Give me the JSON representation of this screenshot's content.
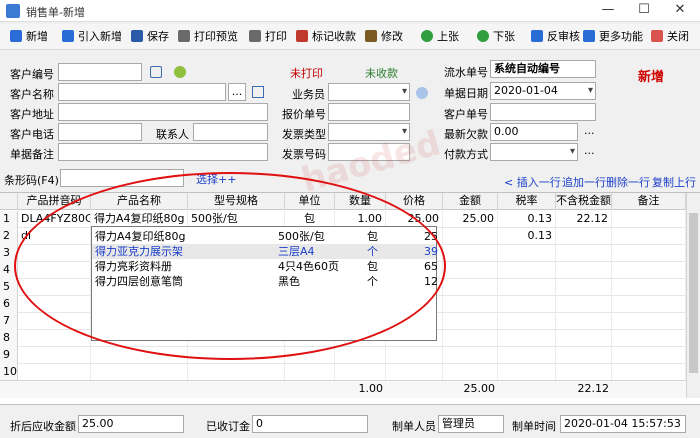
{
  "window": {
    "title": "销售单-新增",
    "min_glyph": "—",
    "max_glyph": "☐",
    "close_glyph": "✕"
  },
  "toolbar": [
    {
      "name": "new-button",
      "icon": "plus-icon",
      "color": "#2a6cd6",
      "label": "新增"
    },
    {
      "name": "import-add-button",
      "icon": "plus-icon",
      "color": "#2a6cd6",
      "label": "引入新增"
    },
    {
      "name": "save-button",
      "icon": "disk-icon",
      "color": "#2a5aa8",
      "label": "保存"
    },
    {
      "name": "print-preview-button",
      "icon": "printer-icon",
      "color": "#6a6a6a",
      "label": "打印预览"
    },
    {
      "name": "print-button",
      "icon": "printer-icon",
      "color": "#6a6a6a",
      "label": "打印"
    },
    {
      "name": "mark-paid-button",
      "icon": "dots-icon",
      "color": "#c0392b",
      "label": "标记收款"
    },
    {
      "name": "edit-button",
      "icon": "tools-icon",
      "color": "#7a5a20",
      "label": "修改"
    },
    {
      "name": "prev-button",
      "icon": "up-circle-icon",
      "color": "#2e9e3e",
      "label": "上张"
    },
    {
      "name": "next-button",
      "icon": "down-circle-icon",
      "color": "#2e9e3e",
      "label": "下张"
    },
    {
      "name": "unaudit-button",
      "icon": "undo-icon",
      "color": "#2a6cd6",
      "label": "反审核"
    },
    {
      "name": "more-button",
      "icon": "grid-icon",
      "color": "#2a6cd6",
      "label": "更多功能"
    },
    {
      "name": "close-button",
      "icon": "close-icon",
      "color": "#d9534f",
      "label": "关闭"
    }
  ],
  "form": {
    "customer_code": {
      "label": "客户编号",
      "value": ""
    },
    "customer_name": {
      "label": "客户名称",
      "value": "",
      "button": "..."
    },
    "customer_address": {
      "label": "客户地址",
      "value": ""
    },
    "customer_phone": {
      "label": "客户电话",
      "value": ""
    },
    "contact": {
      "label": "联系人",
      "value": ""
    },
    "remark": {
      "label": "单据备注",
      "value": ""
    },
    "print_status": "未打印",
    "pay_status": "未收款",
    "salesman": {
      "label": "业务员",
      "value": ""
    },
    "quote_no": {
      "label": "报价单号",
      "value": ""
    },
    "invoice_type": {
      "label": "发票类型",
      "value": ""
    },
    "invoice_no": {
      "label": "发票号码",
      "value": ""
    },
    "serial_no": {
      "label": "流水单号",
      "value": "系统自动编号"
    },
    "doc_date": {
      "label": "单据日期",
      "value": "2020-01-04"
    },
    "customer_order_no": {
      "label": "客户单号",
      "value": ""
    },
    "latest_debt": {
      "label": "最新欠款",
      "value": "0.00"
    },
    "pay_method": {
      "label": "付款方式",
      "value": ""
    },
    "mode_badge": "新增",
    "watermark": "haoded"
  },
  "barcode": {
    "label": "条形码(F4)",
    "value": "",
    "select_link": "选择++"
  },
  "row_actions": {
    "insert": "< 插入一行",
    "append": "追加一行",
    "delete": "删除一行",
    "copy": "复制上行"
  },
  "grid": {
    "columns": [
      "产品拼音码",
      "产品名称",
      "型号规格",
      "单位",
      "数量",
      "价格",
      "金额",
      "税率",
      "不含税金额",
      "备注"
    ],
    "rows": [
      {
        "num": "1",
        "cells": [
          "DLA4FYZ80G",
          "得力A4复印纸80g",
          "500张/包",
          "包",
          "1.00",
          "25.00",
          "25.00",
          "0.13",
          "22.12",
          ""
        ]
      },
      {
        "num": "2",
        "cells": [
          "dl",
          "",
          "",
          "",
          "",
          "",
          "",
          "0.13",
          "",
          ""
        ]
      },
      {
        "num": "3",
        "cells": [
          "",
          "",
          "",
          "",
          "",
          "",
          "",
          "",
          "",
          ""
        ]
      },
      {
        "num": "4",
        "cells": [
          "",
          "",
          "",
          "",
          "",
          "",
          "",
          "",
          "",
          ""
        ]
      },
      {
        "num": "5",
        "cells": [
          "",
          "",
          "",
          "",
          "",
          "",
          "",
          "",
          "",
          ""
        ]
      },
      {
        "num": "6",
        "cells": [
          "",
          "",
          "",
          "",
          "",
          "",
          "",
          "",
          "",
          ""
        ]
      },
      {
        "num": "7",
        "cells": [
          "",
          "",
          "",
          "",
          "",
          "",
          "",
          "",
          "",
          ""
        ]
      },
      {
        "num": "8",
        "cells": [
          "",
          "",
          "",
          "",
          "",
          "",
          "",
          "",
          "",
          ""
        ]
      },
      {
        "num": "9",
        "cells": [
          "",
          "",
          "",
          "",
          "",
          "",
          "",
          "",
          "",
          ""
        ]
      },
      {
        "num": "10",
        "cells": [
          "",
          "",
          "",
          "",
          "",
          "",
          "",
          "",
          "",
          ""
        ]
      }
    ],
    "totals": {
      "qty": "1.00",
      "amount": "25.00",
      "net": "22.12"
    }
  },
  "popup": [
    {
      "name": "得力A4复印纸80g",
      "spec": "500张/包",
      "unit": "包",
      "price": "25"
    },
    {
      "name": "得力亚克力展示架",
      "spec": "三层A4",
      "unit": "个",
      "price": "39"
    },
    {
      "name": "得力亮彩资料册",
      "spec": "4只4色60页",
      "unit": "包",
      "price": "65"
    },
    {
      "name": "得力四层创意笔筒",
      "spec": "黑色",
      "unit": "个",
      "price": "12"
    }
  ],
  "bottom": {
    "receivable_label": "折后应收金额",
    "receivable_value": "25.00",
    "deposit_label": "已收订金",
    "deposit_value": "0",
    "maker_label": "制单人员",
    "maker_value": "管理员",
    "time_label": "制单时间",
    "time_value": "2020-01-04 15:57:53"
  }
}
